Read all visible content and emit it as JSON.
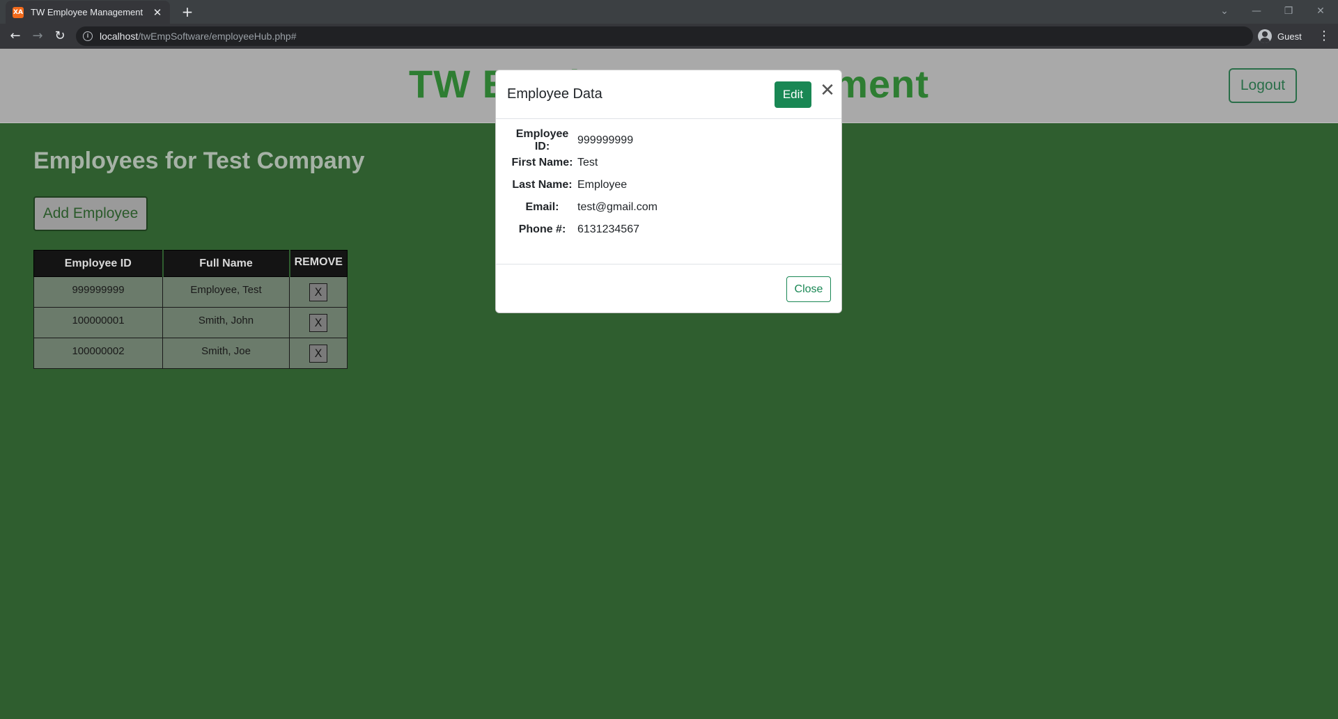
{
  "browser": {
    "tab_title": "TW Employee Management",
    "favicon_text": "XA",
    "url_host": "localhost",
    "url_path": "/twEmpSoftware/employeeHub.php#",
    "profile_label": "Guest"
  },
  "header": {
    "site_title": "TW Employee Management",
    "logout_label": "Logout"
  },
  "main": {
    "company_heading": "Employees for Test Company",
    "add_employee_label": "Add Employee",
    "table": {
      "columns": [
        "Employee ID",
        "Full Name",
        "REMOVE"
      ],
      "rows": [
        {
          "id": "999999999",
          "name": "Employee, Test",
          "remove": "X"
        },
        {
          "id": "100000001",
          "name": "Smith, John",
          "remove": "X"
        },
        {
          "id": "100000002",
          "name": "Smith, Joe",
          "remove": "X"
        }
      ]
    }
  },
  "modal": {
    "title": "Employee Data",
    "edit_label": "Edit",
    "close_label": "Close",
    "fields": [
      {
        "label": "Employee ID:",
        "value": "999999999"
      },
      {
        "label": "First Name:",
        "value": "Test"
      },
      {
        "label": "Last Name:",
        "value": "Employee"
      },
      {
        "label": "Email:",
        "value": "test@gmail.com"
      },
      {
        "label": "Phone #:",
        "value": "6131234567"
      }
    ]
  },
  "colors": {
    "page_background": "#2f5e2f",
    "header_background": "#a9a9a9",
    "title_green": "#2e7d32",
    "button_success": "#198754"
  }
}
